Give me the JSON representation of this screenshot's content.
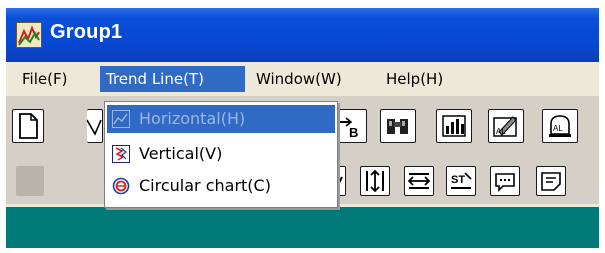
{
  "window": {
    "title": "Group1",
    "icon": "trend-chart-icon"
  },
  "menubar": {
    "items": [
      {
        "label": "File(F)"
      },
      {
        "label": "Trend Line(T)"
      },
      {
        "label": "Window(W)"
      },
      {
        "label": "Help(H)"
      }
    ]
  },
  "dropdown": {
    "items": [
      {
        "label": "Horizontal(H)",
        "icon": "horizontal-trend-icon",
        "state": "disabled-highlighted"
      },
      {
        "label": "Vertical(V)",
        "icon": "vertical-trend-icon",
        "state": "normal"
      },
      {
        "label": "Circular chart(C)",
        "icon": "circular-chart-icon",
        "state": "normal"
      }
    ]
  },
  "toolbar": {
    "row1_icons": [
      "new-document-icon",
      "open-icon",
      "a-to-b-icon",
      "binoculars-icon",
      "bar-chart-icon",
      "edit-chart-icon",
      "alarm-icon"
    ],
    "row2_icons": [
      "disabled-icon",
      "arrow-icon",
      "vertical-resize-icon",
      "horizontal-resize-icon",
      "text-tool-icon",
      "comment-icon",
      "note-icon"
    ]
  },
  "colors": {
    "titlebar": "#0846d0",
    "menubar": "#ece9d8",
    "highlight": "#316ac5",
    "toolbar": "#d4d0c8",
    "workspace": "#007a78"
  }
}
